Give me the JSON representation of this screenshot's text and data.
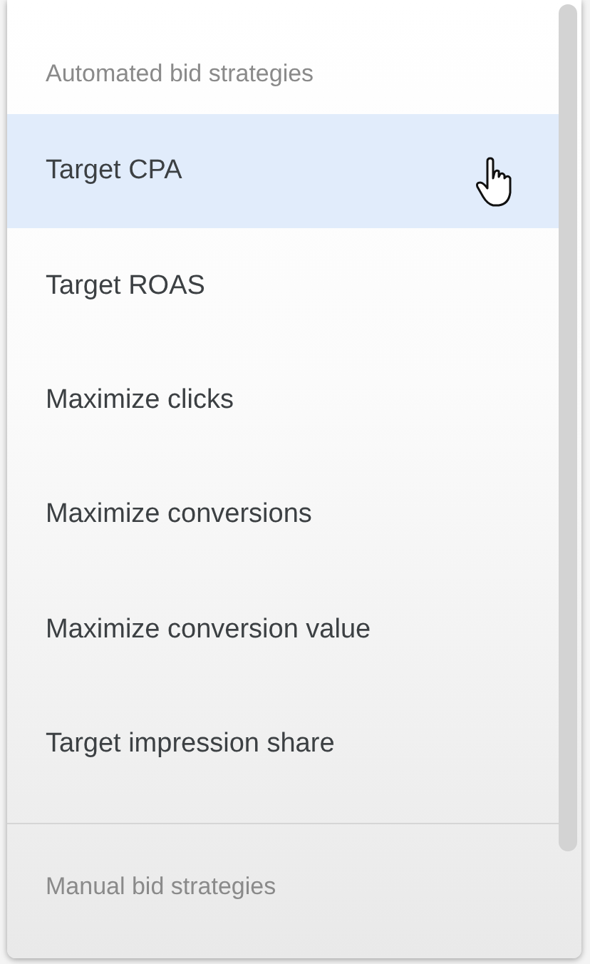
{
  "groups": [
    {
      "header": "Automated bid strategies",
      "items": [
        {
          "label": "Target CPA",
          "selected": true
        },
        {
          "label": "Target ROAS",
          "selected": false
        },
        {
          "label": "Maximize clicks",
          "selected": false
        },
        {
          "label": "Maximize conversions",
          "selected": false
        },
        {
          "label": "Maximize conversion value",
          "selected": false
        },
        {
          "label": "Target impression share",
          "selected": false
        }
      ]
    },
    {
      "header": "Manual bid strategies"
    }
  ]
}
